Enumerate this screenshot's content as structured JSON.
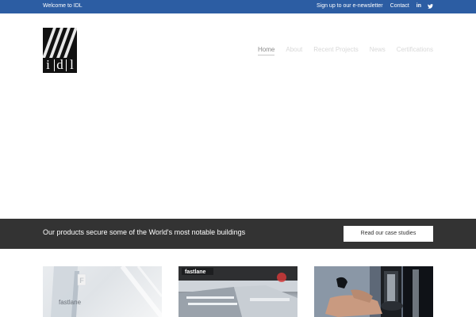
{
  "topbar": {
    "welcome": "Welcome to IDL",
    "newsletter": "Sign up to our e-newsletter",
    "contact": "Contact",
    "linkedin": "in"
  },
  "logo": {
    "letters": [
      "i",
      "d",
      "l"
    ]
  },
  "nav": {
    "items": [
      "Home",
      "About",
      "Recent Projects",
      "News",
      "Certifications"
    ]
  },
  "banner": {
    "text": "Our products secure some of the World's most notable buildings",
    "cta": "Read our case studies"
  },
  "tiles": {
    "tile1_logo": "F",
    "tile1_label": "fastlane",
    "tile2_label": "fastlane"
  },
  "colors": {
    "topbar": "#2c5da3",
    "banner": "#333333",
    "nav_active": "#8a8a8a",
    "nav_inactive": "#d8d8d8"
  }
}
